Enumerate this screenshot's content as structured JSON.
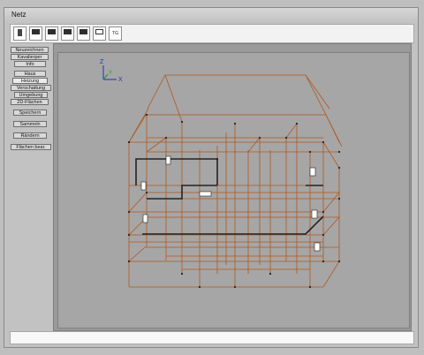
{
  "window": {
    "title": "Netz"
  },
  "toolbar": {
    "buttons": [
      {
        "name": "tool-button-1",
        "label": ""
      },
      {
        "name": "tool-button-2",
        "label": ""
      },
      {
        "name": "tool-button-3",
        "label": ""
      },
      {
        "name": "tool-button-4",
        "label": ""
      },
      {
        "name": "tool-button-5",
        "label": ""
      },
      {
        "name": "tool-button-6",
        "label": ""
      },
      {
        "name": "tool-button-tg",
        "label": "TG"
      }
    ]
  },
  "sidebar": {
    "items": [
      {
        "label": "Neuzeichnen"
      },
      {
        "label": "Kavalierper"
      },
      {
        "label": "Info"
      },
      {
        "label": "Haus"
      },
      {
        "label": "Heizung"
      },
      {
        "label": "Verschattung"
      },
      {
        "label": "Umgebung"
      },
      {
        "label": "2D-Flächen"
      },
      {
        "label": "Speichern"
      },
      {
        "label": "Sammeln"
      },
      {
        "label": "Rändern"
      },
      {
        "label": "Flächen bear."
      }
    ]
  },
  "viewport": {
    "axes": {
      "x": "X",
      "y": "Y",
      "z": "Z"
    },
    "colors": {
      "wireframe": "#b0581c",
      "axis_blue": "#2230b8",
      "axis_green": "#1c9a2c",
      "background": "#a6a6a6"
    }
  },
  "statusbar": {
    "text": ""
  }
}
